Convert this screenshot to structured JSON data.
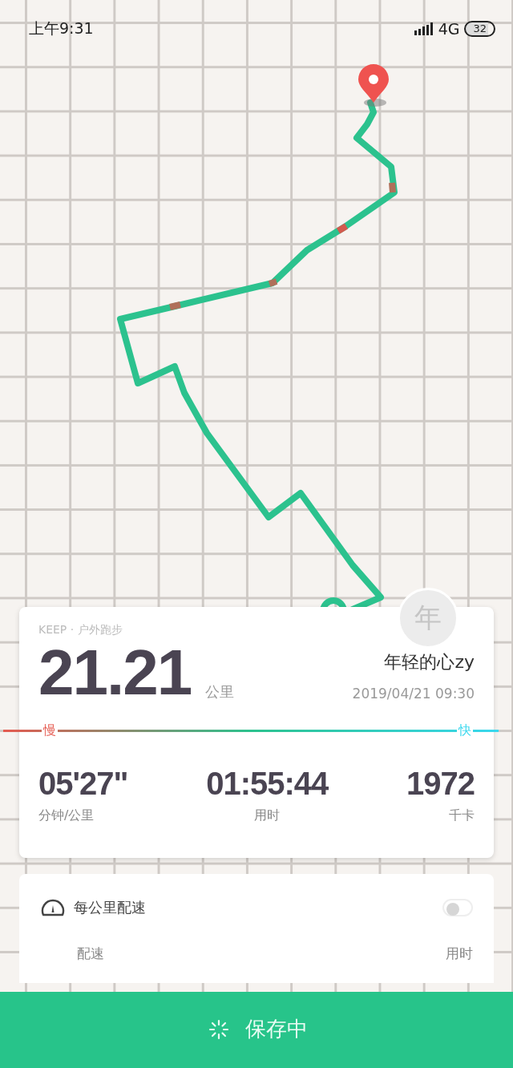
{
  "status_bar": {
    "time": "上午9:31",
    "network": "4G",
    "battery": "32"
  },
  "summary": {
    "source": "KEEP · 户外跑步",
    "distance": "21.21",
    "distance_unit": "公里",
    "avatar": "年",
    "user": "年轻的心zy",
    "datetime": "2019/04/21 09:30",
    "slow_label": "慢",
    "fast_label": "快",
    "stats": [
      {
        "value": "05'27\"",
        "label": "分钟/公里"
      },
      {
        "value": "01:55:44",
        "label": "用时"
      },
      {
        "value": "1972",
        "label": "千卡"
      }
    ]
  },
  "pace_panel": {
    "title": "每公里配速",
    "toggle_on": false,
    "columns": [
      "配速",
      "用时"
    ]
  },
  "save_button": {
    "label": "保存中"
  }
}
